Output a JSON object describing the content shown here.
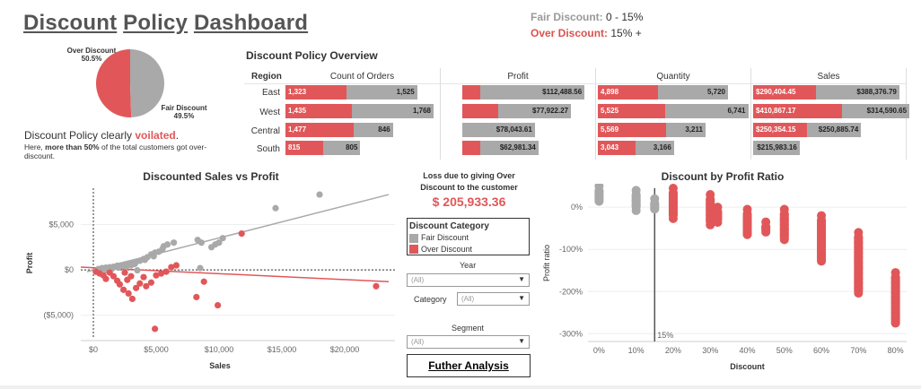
{
  "header": {
    "title_words": [
      "Discount",
      "Policy",
      "Dashboard"
    ],
    "fair_label": "Fair Discount:",
    "fair_range": "0 - 15%",
    "over_label": "Over Discount:",
    "over_range": "15% +"
  },
  "pie": {
    "over_label": "Over Discount",
    "over_pct": "50.5%",
    "fair_label": "Fair Discount",
    "fair_pct": "49.5%",
    "over_value": 50.5,
    "fair_value": 49.5,
    "colors": {
      "over": "#e15759",
      "fair": "#a9a9a9"
    }
  },
  "verdict": {
    "line1_prefix": "Discount Policy clearly ",
    "line1_emph": "voilated",
    "line1_suffix": ".",
    "line2_prefix": "Here, ",
    "line2_bold": "more than 50%",
    "line2_suffix": " of the total customers got over-",
    "line3": "discount."
  },
  "overview": {
    "title": "Discount Policy Overview",
    "col_region": "Region",
    "columns": [
      "Count of Orders",
      "Profit",
      "Quantity",
      "Sales"
    ],
    "rows": [
      {
        "region": "East",
        "orders": [
          {
            "label": "1,323",
            "value": 1323
          },
          {
            "label": "1,525",
            "value": 1525
          }
        ],
        "profit": [
          {
            "label": "",
            "value": 19000
          },
          {
            "label": "$112,488.56",
            "value": 112488.56
          }
        ],
        "quantity": [
          {
            "label": "4,898",
            "value": 4898
          },
          {
            "label": "5,720",
            "value": 5720
          }
        ],
        "sales": [
          {
            "label": "$290,404.45",
            "value": 290404.45
          },
          {
            "label": "$388,376.79",
            "value": 388376.79
          }
        ]
      },
      {
        "region": "West",
        "orders": [
          {
            "label": "1,435",
            "value": 1435
          },
          {
            "label": "1,768",
            "value": 1768
          }
        ],
        "profit": [
          {
            "label": "",
            "value": 39000
          },
          {
            "label": "$77,922.27",
            "value": 77922.27
          }
        ],
        "quantity": [
          {
            "label": "5,525",
            "value": 5525
          },
          {
            "label": "6,741",
            "value": 6741
          }
        ],
        "sales": [
          {
            "label": "$410,867.17",
            "value": 410867.17
          },
          {
            "label": "$314,590.65",
            "value": 314590.65
          }
        ]
      },
      {
        "region": "Central",
        "orders": [
          {
            "label": "1,477",
            "value": 1477
          },
          {
            "label": "846",
            "value": 846
          }
        ],
        "profit": [
          {
            "label": "",
            "value": 0
          },
          {
            "label": "$78,043.61",
            "value": 78043.61
          }
        ],
        "quantity": [
          {
            "label": "5,569",
            "value": 5569
          },
          {
            "label": "3,211",
            "value": 3211
          }
        ],
        "sales": [
          {
            "label": "$250,354.15",
            "value": 250354.15
          },
          {
            "label": "$250,885.74",
            "value": 250885.74
          }
        ]
      },
      {
        "region": "South",
        "orders": [
          {
            "label": "815",
            "value": 815
          },
          {
            "label": "805",
            "value": 805
          }
        ],
        "profit": [
          {
            "label": "",
            "value": 19000
          },
          {
            "label": "$62,981.34",
            "value": 62981.34
          }
        ],
        "quantity": [
          {
            "label": "3,043",
            "value": 3043
          },
          {
            "label": "3,166",
            "value": 3166
          }
        ],
        "sales": [
          {
            "label": "",
            "value": 0
          },
          {
            "label": "$215,983.16",
            "value": 215983.16
          }
        ]
      }
    ]
  },
  "loss": {
    "line1": "Loss due to giving Over",
    "line2": "Discount to the customer",
    "amount": "$ 205,933.36"
  },
  "category_legend": {
    "title": "Discount Category",
    "items": [
      {
        "label": "Fair Discount",
        "color": "#a9a9a9"
      },
      {
        "label": "Over Discount",
        "color": "#e15759"
      }
    ]
  },
  "filters": {
    "year_label": "Year",
    "year_value": "(All)",
    "category_label": "Category",
    "category_value": "(All)",
    "segment_label": "Segment",
    "segment_value": "(All)",
    "further_label": "Futher Analysis"
  },
  "chart_data": [
    {
      "type": "scatter",
      "title": "Discounted Sales vs Profit",
      "xlabel": "Sales",
      "ylabel": "Profit",
      "xlim": [
        -1000,
        24000
      ],
      "ylim": [
        -7500,
        9000
      ],
      "x_ticks": [
        {
          "v": 0,
          "label": "$0"
        },
        {
          "v": 5000,
          "label": "$5,000"
        },
        {
          "v": 10000,
          "label": "$10,000"
        },
        {
          "v": 15000,
          "label": "$15,000"
        },
        {
          "v": 20000,
          "label": "$20,000"
        }
      ],
      "y_ticks": [
        {
          "v": 5000,
          "label": "$5,000"
        },
        {
          "v": 0,
          "label": "$0"
        },
        {
          "v": -5000,
          "label": "($5,000)"
        }
      ],
      "series": [
        {
          "name": "Fair Discount",
          "color": "#a9a9a9",
          "trend": [
            [
              -500,
              -200
            ],
            [
              23500,
              8300
            ]
          ],
          "points": [
            [
              400,
              100
            ],
            [
              700,
              200
            ],
            [
              1000,
              250
            ],
            [
              1300,
              300
            ],
            [
              1600,
              350
            ],
            [
              1900,
              450
            ],
            [
              2200,
              500
            ],
            [
              2500,
              600
            ],
            [
              2800,
              700
            ],
            [
              3100,
              800
            ],
            [
              3400,
              900
            ],
            [
              3700,
              1000
            ],
            [
              4000,
              1200
            ],
            [
              4300,
              1400
            ],
            [
              4600,
              1700
            ],
            [
              4900,
              1900
            ],
            [
              5200,
              2000
            ],
            [
              5500,
              2300
            ],
            [
              600,
              50
            ],
            [
              900,
              100
            ],
            [
              1500,
              150
            ],
            [
              2000,
              250
            ],
            [
              2600,
              350
            ],
            [
              3000,
              500
            ],
            [
              3300,
              650
            ],
            [
              4100,
              1100
            ],
            [
              4800,
              1500
            ],
            [
              5600,
              2600
            ],
            [
              5900,
              2800
            ],
            [
              6400,
              3000
            ],
            [
              8300,
              3300
            ],
            [
              9400,
              2500
            ],
            [
              9700,
              2800
            ],
            [
              10000,
              3000
            ],
            [
              10300,
              3500
            ],
            [
              8600,
              3000
            ],
            [
              14500,
              6800
            ],
            [
              18000,
              8300
            ],
            [
              8500,
              200
            ],
            [
              3500,
              -50
            ],
            [
              1100,
              -30
            ]
          ]
        },
        {
          "name": "Over Discount",
          "color": "#e15759",
          "trend": [
            [
              -1000,
              300
            ],
            [
              23500,
              -1300
            ]
          ],
          "points": [
            [
              200,
              -200
            ],
            [
              500,
              -400
            ],
            [
              800,
              -600
            ],
            [
              1000,
              -1000
            ],
            [
              1300,
              -300
            ],
            [
              1600,
              -700
            ],
            [
              1900,
              -1200
            ],
            [
              2100,
              -1600
            ],
            [
              2400,
              -2200
            ],
            [
              2800,
              -2600
            ],
            [
              3100,
              -3200
            ],
            [
              3400,
              -2000
            ],
            [
              3700,
              -1500
            ],
            [
              4000,
              -800
            ],
            [
              4200,
              -1800
            ],
            [
              4600,
              -1400
            ],
            [
              5000,
              -600
            ],
            [
              5400,
              -400
            ],
            [
              5800,
              -200
            ],
            [
              6200,
              300
            ],
            [
              6600,
              500
            ],
            [
              4900,
              -6500
            ],
            [
              8800,
              -1300
            ],
            [
              8200,
              -3000
            ],
            [
              9900,
              -3900
            ],
            [
              11800,
              4000
            ],
            [
              22500,
              -1800
            ],
            [
              3000,
              -700
            ],
            [
              2500,
              -300
            ],
            [
              2700,
              -1100
            ]
          ]
        }
      ]
    },
    {
      "type": "scatter",
      "title": "Discount by Profit Ratio",
      "xlabel": "Discount",
      "ylabel": "Profit ratio",
      "xlim": [
        -3,
        83
      ],
      "ylim": [
        -310,
        45
      ],
      "x_ticks": [
        {
          "v": 0,
          "label": "0%"
        },
        {
          "v": 10,
          "label": "10%"
        },
        {
          "v": 20,
          "label": "20%"
        },
        {
          "v": 30,
          "label": "30%"
        },
        {
          "v": 40,
          "label": "40%"
        },
        {
          "v": 50,
          "label": "50%"
        },
        {
          "v": 60,
          "label": "60%"
        },
        {
          "v": 70,
          "label": "70%"
        },
        {
          "v": 80,
          "label": "80%"
        }
      ],
      "y_ticks": [
        {
          "v": 0,
          "label": "0%"
        },
        {
          "v": -100,
          "label": "-100%"
        },
        {
          "v": -200,
          "label": "-200%"
        },
        {
          "v": -300,
          "label": "-300%"
        }
      ],
      "reference_line": {
        "value": 15,
        "label": "15%"
      },
      "series": [
        {
          "name": "Fair Discount",
          "color": "#a9a9a9",
          "columns": [
            {
              "x": 0,
              "min": 5,
              "max": 50
            },
            {
              "x": 10,
              "min": -10,
              "max": 40
            },
            {
              "x": 15,
              "min": -15,
              "max": 20
            }
          ]
        },
        {
          "name": "Over Discount",
          "color": "#e15759",
          "columns": [
            {
              "x": 20,
              "min": -30,
              "max": 45
            },
            {
              "x": 30,
              "min": -45,
              "max": 30
            },
            {
              "x": 32,
              "min": -40,
              "max": 0
            },
            {
              "x": 40,
              "min": -75,
              "max": -5
            },
            {
              "x": 45,
              "min": -65,
              "max": -35
            },
            {
              "x": 50,
              "min": -85,
              "max": -5
            },
            {
              "x": 60,
              "min": -135,
              "max": -20
            },
            {
              "x": 70,
              "min": -210,
              "max": -60
            },
            {
              "x": 80,
              "min": -285,
              "max": -155
            }
          ]
        }
      ]
    }
  ]
}
